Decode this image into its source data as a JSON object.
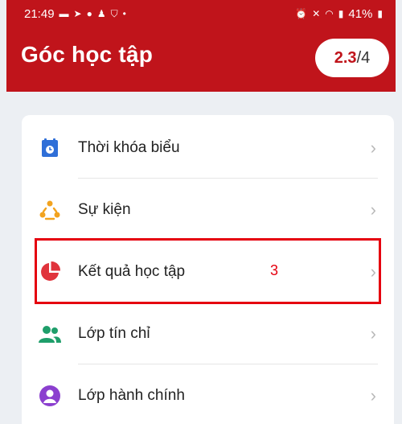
{
  "status_bar": {
    "time": "21:49",
    "battery": "41%"
  },
  "header": {
    "title": "Góc học tập",
    "score_value": "2.3",
    "score_total": "/4"
  },
  "menu": {
    "items": [
      {
        "label": "Thời khóa biểu",
        "icon": "calendar-icon"
      },
      {
        "label": "Sự kiện",
        "icon": "event-people-icon"
      },
      {
        "label": "Kết quả học tập",
        "icon": "pie-chart-icon"
      },
      {
        "label": "Lớp tín chỉ",
        "icon": "group-icon"
      },
      {
        "label": "Lớp hành chính",
        "icon": "person-icon"
      }
    ]
  },
  "annotation": {
    "step_number": "3"
  },
  "colors": {
    "brand_red": "#c0141b",
    "highlight_red": "#e5000f",
    "calendar_blue": "#2f6fd8",
    "event_orange": "#f2a31f",
    "pie_red": "#e0343c",
    "group_green": "#1e9e6a",
    "person_purple": "#8b3fcf"
  }
}
